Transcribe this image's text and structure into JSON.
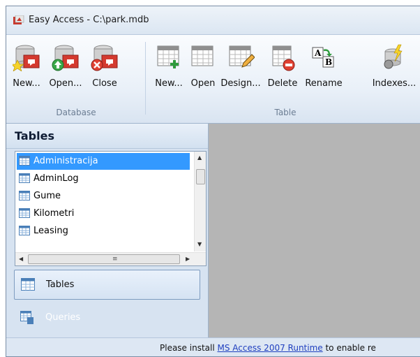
{
  "window": {
    "title": "Easy Access - C:\\park.mdb"
  },
  "ribbon": {
    "database_group": {
      "label": "Database",
      "buttons": [
        {
          "label": "New...",
          "icon": "database-new-icon"
        },
        {
          "label": "Open...",
          "icon": "database-open-icon"
        },
        {
          "label": "Close",
          "icon": "database-close-icon"
        }
      ]
    },
    "table_group": {
      "label": "Table",
      "buttons": [
        {
          "label": "New...",
          "icon": "table-new-icon"
        },
        {
          "label": "Open",
          "icon": "table-open-icon"
        },
        {
          "label": "Design...",
          "icon": "table-design-icon"
        },
        {
          "label": "Delete",
          "icon": "table-delete-icon"
        },
        {
          "label": "Rename",
          "icon": "table-rename-icon"
        },
        {
          "label": "Indexes...",
          "icon": "indexes-icon"
        }
      ]
    }
  },
  "tables_panel": {
    "title": "Tables",
    "items": [
      "Administracija",
      "AdminLog",
      "Gume",
      "Kilometri",
      "Leasing"
    ],
    "selected": "Administracija"
  },
  "nav": {
    "tables_label": "Tables",
    "queries_label": "Queries"
  },
  "status": {
    "prefix": "Please install ",
    "link": "MS Access 2007 Runtime",
    "suffix": " to enable re"
  },
  "colors": {
    "selection": "#3399ff",
    "link": "#1f3fbf",
    "content_bg": "#b5b5b5"
  }
}
